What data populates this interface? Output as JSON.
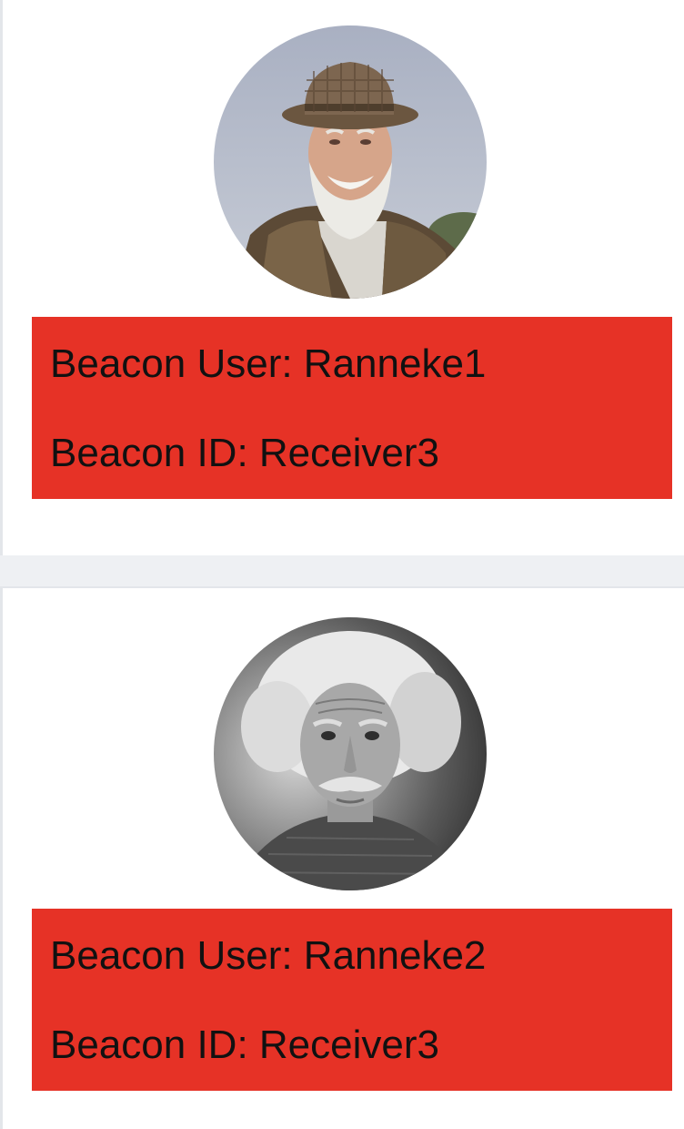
{
  "beacons": [
    {
      "avatar_icon": "avatar-photo-man-in-hat",
      "user_text": "Beacon User: Ranneke1",
      "id_text": "Beacon ID: Receiver3"
    },
    {
      "avatar_icon": "avatar-photo-grayscale-portrait",
      "user_text": "Beacon User: Ranneke2",
      "id_text": "Beacon ID: Receiver3"
    }
  ],
  "colors": {
    "info_background": "#e63226",
    "page_background": "#eef0f3",
    "card_background": "#ffffff"
  }
}
